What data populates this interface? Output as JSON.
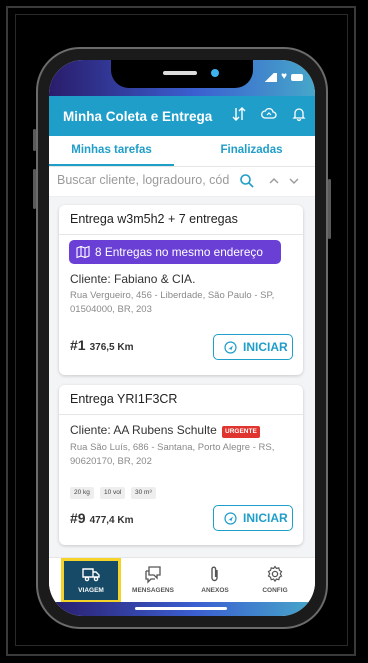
{
  "app": {
    "title": "Minha Coleta e Entrega"
  },
  "tabs": [
    {
      "label": "Minhas tarefas",
      "active": true
    },
    {
      "label": "Finalizadas",
      "active": false
    }
  ],
  "search": {
    "placeholder": "Buscar cliente, logradouro, cód"
  },
  "tasks": [
    {
      "title": "Entrega w3m5h2 + 7 entregas",
      "banner": "8 Entregas no mesmo endereço",
      "client": "Cliente: Fabiano & CIA.",
      "address": "Rua Vergueiro, 456 - Liberdade, São Paulo - SP, 01504000, BR, 203",
      "number": "#1",
      "distance": "376,5 Km",
      "button": "INICIAR"
    },
    {
      "title": "Entrega YRI1F3CR",
      "client": "Cliente: AA Rubens Schulte",
      "badge": "URGENTE",
      "address": "Rua São Luís, 686 - Santana, Porto Alegre - RS, 90620170, BR, 202",
      "tags": [
        "20 kg",
        "10 vol",
        "30 m³"
      ],
      "number": "#9",
      "distance": "477,4 Km",
      "button": "INICIAR"
    }
  ],
  "bottom_nav": [
    {
      "label": "VIAGEM",
      "icon": "truck-icon",
      "active": true
    },
    {
      "label": "MENSAGENS",
      "icon": "chat-icon",
      "active": false
    },
    {
      "label": "ANEXOS",
      "icon": "paperclip-icon",
      "active": false
    },
    {
      "label": "CONFIG",
      "icon": "gear-icon",
      "active": false
    }
  ],
  "colors": {
    "primary": "#1f9ec9",
    "banner": "#6a3fd6",
    "urgent": "#e0342f",
    "nav_active_bg": "#164a66",
    "highlight": "#f5d328"
  }
}
